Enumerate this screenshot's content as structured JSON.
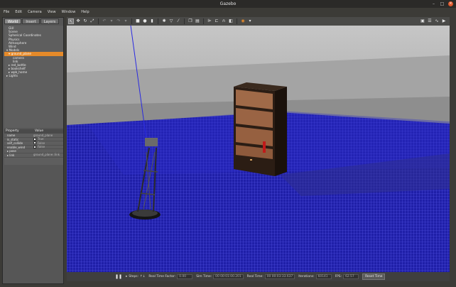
{
  "window": {
    "title": "Gazebo"
  },
  "menu": [
    "File",
    "Edit",
    "Camera",
    "View",
    "Window",
    "Help"
  ],
  "tabs": [
    "World",
    "Insert",
    "Layers"
  ],
  "tree": [
    {
      "label": "GUI",
      "indent": 2,
      "arrow": ""
    },
    {
      "label": "Scene",
      "indent": 2,
      "arrow": ""
    },
    {
      "label": "Spherical Coordinates",
      "indent": 2,
      "arrow": ""
    },
    {
      "label": "Physics",
      "indent": 2,
      "arrow": ""
    },
    {
      "label": "Atmosphere",
      "indent": 2,
      "arrow": ""
    },
    {
      "label": "Wind",
      "indent": 2,
      "arrow": ""
    },
    {
      "label": "Models",
      "indent": 1,
      "arrow": "▾"
    },
    {
      "label": "ground_plane",
      "indent": 2,
      "arrow": "▾",
      "state": "sel"
    },
    {
      "label": "camera",
      "indent": 4,
      "arrow": ""
    },
    {
      "label": "link",
      "indent": 4,
      "arrow": ""
    },
    {
      "label": "red_bottle",
      "indent": 2,
      "arrow": "▸"
    },
    {
      "label": "bookshelf",
      "indent": 2,
      "arrow": "▸"
    },
    {
      "label": "wpb_home",
      "indent": 2,
      "arrow": "▸"
    },
    {
      "label": "Lights",
      "indent": 1,
      "arrow": "▸"
    }
  ],
  "props": {
    "header": [
      "Property",
      "Value"
    ],
    "rows": [
      {
        "key": "name",
        "value": "ground_plane",
        "check": null
      },
      {
        "key": "is_static",
        "value": "True",
        "check": true
      },
      {
        "key": "self_collide",
        "value": "False",
        "check": false
      },
      {
        "key": "enable_wind",
        "value": "False",
        "check": false
      },
      {
        "key": "▸ pose",
        "value": "",
        "check": null
      },
      {
        "key": "▸ link",
        "value": "ground_plane::link",
        "check": null
      }
    ]
  },
  "toolbar": {
    "tools": [
      "select-arrow-icon",
      "translate-icon",
      "rotate-icon",
      "scale-icon"
    ],
    "right": [
      "screenshot-icon",
      "log-icon",
      "plot-icon",
      "video-icon"
    ]
  },
  "status": {
    "pause": "❚❚",
    "steps_label": "Steps:",
    "rtf_label": "Real Time Factor:",
    "rtf": "0.00",
    "sim_label": "Sim Time:",
    "sim": "00 00:01:00.201",
    "real_label": "Real Time:",
    "real": "00 00:03:33.637",
    "iter_label": "Iterations:",
    "iter": "60141",
    "fps_label": "FPS:",
    "fps": "62.57",
    "reset": "Reset Time"
  },
  "colors": {
    "selection": "#e58a2a",
    "grid": "#2f2fd0",
    "close": "#e25a2e"
  }
}
